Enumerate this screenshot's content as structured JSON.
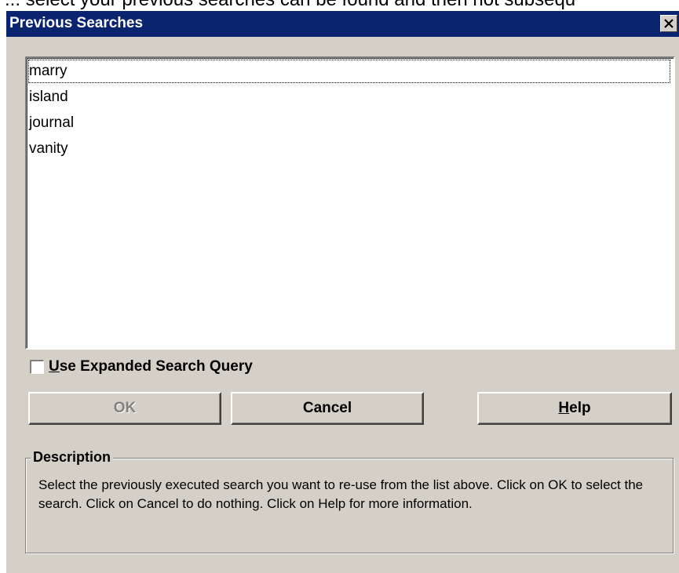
{
  "background_text": "... select your previous searches can be found and then not subsequ",
  "dialog": {
    "title": "Previous Searches",
    "close_icon": "close-icon"
  },
  "list": {
    "items": [
      "marry",
      "island",
      "journal",
      "vanity"
    ],
    "focused_index": 0
  },
  "checkbox": {
    "label_accel": "U",
    "label_rest": "se Expanded Search Query",
    "checked": false
  },
  "buttons": {
    "ok_label": "OK",
    "ok_enabled": false,
    "cancel_label": "Cancel",
    "help_accel": "H",
    "help_rest": "elp"
  },
  "description": {
    "legend": "Description",
    "text": "Select the previously executed search you want to re-use from the list above. Click on OK to select the search. Click on Cancel to do nothing. Click on Help for more information."
  },
  "colors": {
    "titlebar": "#0a2470",
    "face": "#d4d0c8",
    "disabled_text": "#808080"
  }
}
